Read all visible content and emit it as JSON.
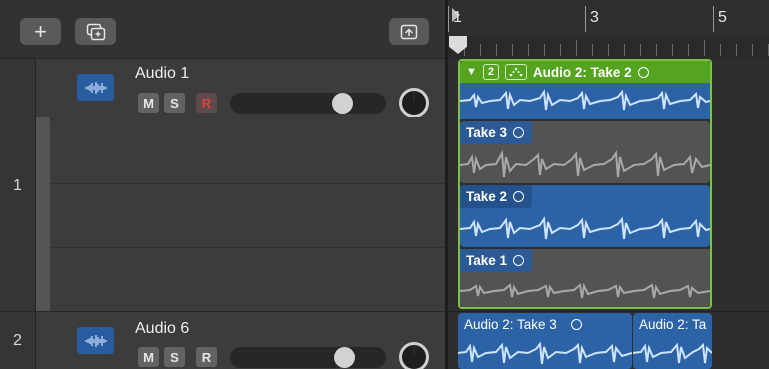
{
  "toolbar": {
    "add_label": "+",
    "add_icon": "plus-icon",
    "new_stack_icon": "track-stack-icon",
    "catch_icon": "catch-playhead-icon"
  },
  "tracks": [
    {
      "number": "1",
      "name": "Audio 1",
      "mute": "M",
      "solo": "S",
      "record": "R",
      "record_armed": true,
      "volume": 0.72,
      "icon": "waveform-icon"
    },
    {
      "number": "2",
      "name": "Audio 6",
      "mute": "M",
      "solo": "S",
      "record": "R",
      "record_armed": false,
      "volume": 0.74,
      "icon": "waveform-icon"
    }
  ],
  "ruler": {
    "bars": [
      "1",
      "3",
      "5"
    ]
  },
  "take_folder": {
    "collapse_glyph": "▼",
    "take_count": "2",
    "comp_icon": "comp-icon",
    "title": "Audio 2: Take 2",
    "color": "#55a420",
    "takes": [
      {
        "label": "Take 3",
        "active": false
      },
      {
        "label": "Take 2",
        "active": true
      },
      {
        "label": "Take 1",
        "active": false
      }
    ]
  },
  "track2_regions": [
    {
      "label": "Audio 2: Take 3"
    },
    {
      "label": "Audio 2: Ta"
    }
  ],
  "colors": {
    "region_blue": "#2c63a6",
    "region_gray": "#535353",
    "comp_green": "#55a420",
    "record_red": "#e04242"
  }
}
